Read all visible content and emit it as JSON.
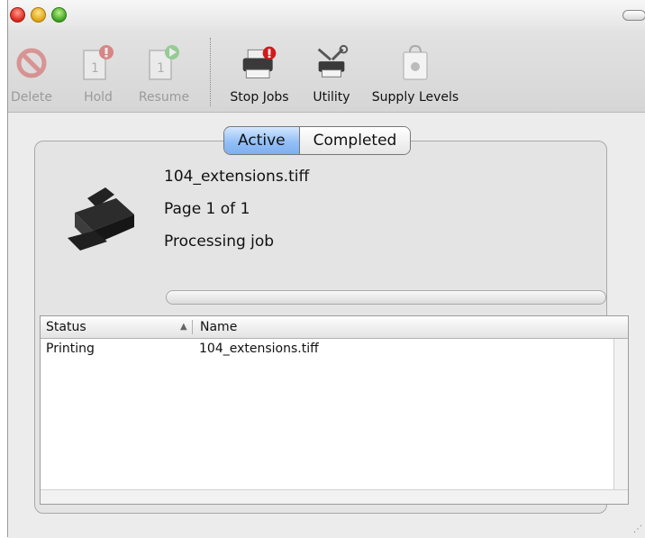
{
  "window": {
    "controls": [
      "close-button",
      "minimize-button",
      "zoom-button"
    ]
  },
  "toolbar": {
    "delete_label": "Delete",
    "hold_label": "Hold",
    "resume_label": "Resume",
    "stop_jobs_label": "Stop Jobs",
    "utility_label": "Utility",
    "supply_levels_label": "Supply Levels"
  },
  "tabs": {
    "active": "Active",
    "completed": "Completed",
    "selected": "Active"
  },
  "job": {
    "filename": "104_extensions.tiff",
    "page": "Page 1 of 1",
    "state": "Processing job",
    "progress": 0
  },
  "table": {
    "headers": {
      "status": "Status",
      "name": "Name"
    },
    "rows": [
      {
        "status": "Printing",
        "name": "104_extensions.tiff"
      }
    ]
  },
  "colors": {
    "selected_tab": "#93c0f6",
    "close": "#d9261c",
    "minimize": "#e0a411",
    "zoom": "#3ea11e",
    "alert_badge": "#d11a1a",
    "resume_badge": "#3fb53f"
  },
  "icons": [
    "delete-icon",
    "hold-icon",
    "resume-icon",
    "stop-jobs-icon",
    "utility-icon",
    "supply-levels-icon",
    "printer-icon",
    "sort-ascending-icon"
  ]
}
